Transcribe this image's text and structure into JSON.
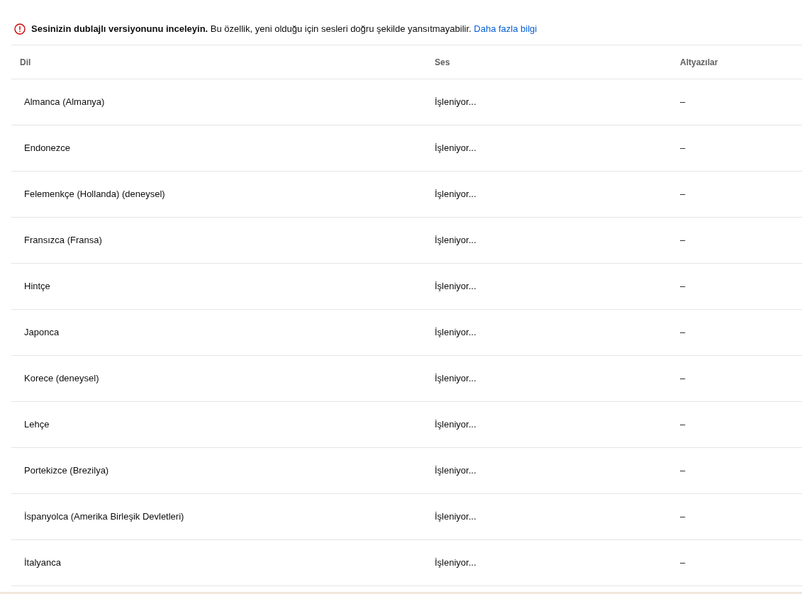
{
  "notice": {
    "title": "Sesinizin dublajlı versiyonunu inceleyin.",
    "message": "Bu özellik, yeni olduğu için sesleri doğru şekilde yansıtmayabilir.",
    "link": "Daha fazla bilgi"
  },
  "table": {
    "columns": [
      "Dil",
      "Ses",
      "Altyazılar"
    ],
    "rows": [
      {
        "language": "Almanca (Almanya)",
        "audio": "İşleniyor...",
        "subtitles": "–"
      },
      {
        "language": "Endonezce",
        "audio": "İşleniyor...",
        "subtitles": "–"
      },
      {
        "language": "Felemenkçe (Hollanda) (deneysel)",
        "audio": "İşleniyor...",
        "subtitles": "–"
      },
      {
        "language": "Fransızca (Fransa)",
        "audio": "İşleniyor...",
        "subtitles": "–"
      },
      {
        "language": "Hintçe",
        "audio": "İşleniyor...",
        "subtitles": "–"
      },
      {
        "language": "Japonca",
        "audio": "İşleniyor...",
        "subtitles": "–"
      },
      {
        "language": "Korece (deneysel)",
        "audio": "İşleniyor...",
        "subtitles": "–"
      },
      {
        "language": "Lehçe",
        "audio": "İşleniyor...",
        "subtitles": "–"
      },
      {
        "language": "Portekizce (Brezilya)",
        "audio": "İşleniyor...",
        "subtitles": "–"
      },
      {
        "language": "İspanyolca (Amerika Birleşik Devletleri)",
        "audio": "İşleniyor...",
        "subtitles": "–"
      },
      {
        "language": "İtalyanca",
        "audio": "İşleniyor...",
        "subtitles": "–"
      }
    ]
  }
}
